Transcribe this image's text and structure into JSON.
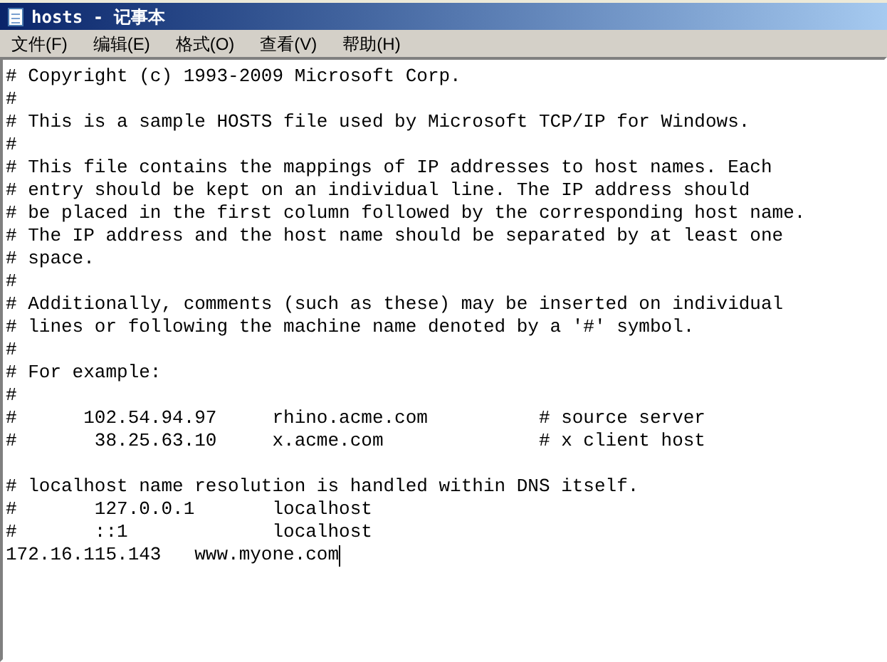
{
  "window": {
    "title": "hosts - 记事本"
  },
  "menu": [
    "文件(F)",
    "编辑(E)",
    "格式(O)",
    "查看(V)",
    "帮助(H)"
  ],
  "editor": {
    "caret": true,
    "paragraphs": [
      [
        "# Copyright (c) 1993-2009 Microsoft Corp.",
        "#",
        "# This is a sample HOSTS file used by Microsoft TCP/IP for Windows.",
        "#",
        "# This file contains the mappings of IP addresses to host names. Each",
        "# entry should be kept on an individual line. The IP address should",
        "# be placed in the first column followed by the corresponding host name.",
        "# The IP address and the host name should be separated by at least one",
        "# space.",
        "#",
        "# Additionally, comments (such as these) may be inserted on individual",
        "# lines or following the machine name denoted by a '#' symbol.",
        "#",
        "# For example:",
        "#",
        "#      102.54.94.97     rhino.acme.com          # source server",
        "#       38.25.63.10     x.acme.com              # x client host"
      ],
      [
        "# localhost name resolution is handled within DNS itself.",
        "#       127.0.0.1       localhost",
        "#       ::1             localhost",
        "172.16.115.143   www.myone.com"
      ]
    ]
  }
}
